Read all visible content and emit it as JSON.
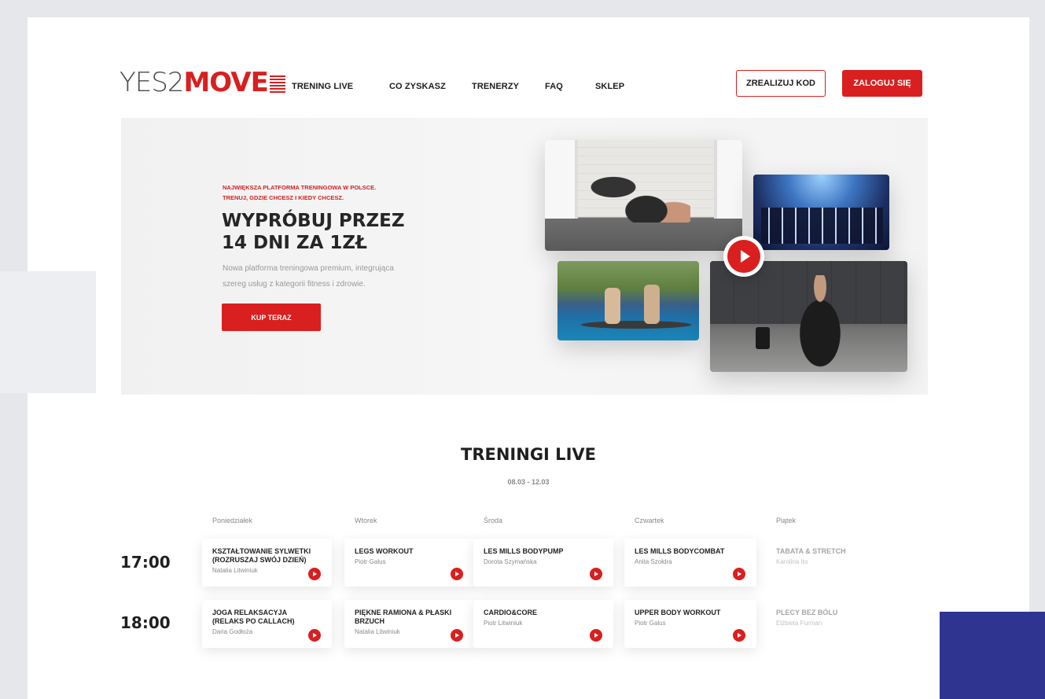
{
  "header": {
    "logo": {
      "light": "YES2",
      "bold": "MOVE"
    },
    "nav": [
      "TRENING LIVE",
      "CO ZYSKASZ",
      "TRENERZY",
      "FAQ",
      "SKLEP"
    ],
    "redeem_label": "ZREALIZUJ KOD",
    "login_label": "ZALOGUJ SIĘ"
  },
  "hero": {
    "tag_line1": "NAJWIĘKSZA PLATFORMA TRENINGOWA W POLSCE.",
    "tag_line2": "TRENUJ, GDZIE CHCESZ I KIEDY CHCESZ.",
    "title_line1": "WYPRÓBUJ PRZEZ",
    "title_line2": "14 DNI ZA 1ZŁ",
    "desc_line1": "Nowa platforma treningowa premium, integrująca",
    "desc_line2": "szereg usług z kategorii fitness i zdrowie.",
    "cta_label": "KUP TERAZ"
  },
  "schedule": {
    "title": "TRENINGI LIVE",
    "dates": "08.03 - 12.03",
    "days": [
      "Poniedziałek",
      "Wtorek",
      "Środa",
      "Czwartek",
      "Piątek"
    ],
    "slots": [
      {
        "time": "17:00",
        "classes": [
          {
            "name": "KSZTAŁTOWANIE SYLWETKI (ROZRUSZAJ SWÓJ DZIEŃ)",
            "trainer": "Natalia Litwiniuk"
          },
          {
            "name": "LEGS WORKOUT",
            "trainer": "Piotr Galus"
          },
          {
            "name": "LES MILLS BODYPUMP",
            "trainer": "Dorota Szymańska"
          },
          {
            "name": "LES MILLS BODYCOMBAT",
            "trainer": "Anita Szołdra"
          },
          {
            "name": "TABATA & STRETCH",
            "trainer": "Karolina Ito"
          }
        ]
      },
      {
        "time": "18:00",
        "classes": [
          {
            "name": "JOGA RELAKSACYJA (RELAKS PO CALLACH)",
            "trainer": "Daria Godłoża"
          },
          {
            "name": "PIĘKNE RAMIONA & PŁASKI BRZUCH",
            "trainer": "Natalia Litwiniuk"
          },
          {
            "name": "CARDIO&CORE",
            "trainer": "Piotr Litwiniuk"
          },
          {
            "name": "UPPER BODY WORKOUT",
            "trainer": "Piotr Galus"
          },
          {
            "name": "PLECY BEZ BÓLU",
            "trainer": "Elżbieta Furman"
          }
        ]
      }
    ]
  },
  "colors": {
    "accent": "#d91f1f",
    "deco_blue": "#2e3490",
    "text_dark": "#1f1f1f"
  }
}
